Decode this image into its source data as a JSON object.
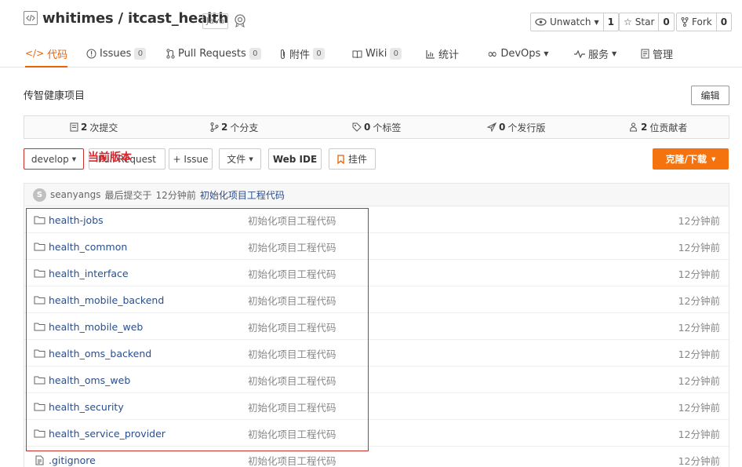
{
  "repo": {
    "owner": "whitimes",
    "name": "itcast_health",
    "separator": " / ",
    "language": "Java"
  },
  "actions": {
    "watch": {
      "label": "Unwatch",
      "count": "1"
    },
    "star": {
      "label": "Star",
      "count": "0"
    },
    "fork": {
      "label": "Fork",
      "count": "0"
    }
  },
  "nav": {
    "code": "代码",
    "issues": {
      "label": "Issues",
      "count": "0"
    },
    "pull_requests": {
      "label": "Pull Requests",
      "count": "0"
    },
    "attachments": {
      "label": "附件",
      "count": "0"
    },
    "wiki": {
      "label": "Wiki",
      "count": "0"
    },
    "stats": "统计",
    "devops": "DevOps",
    "services": "服务",
    "manage": "管理"
  },
  "description": "传智健康项目",
  "edit_label": "编辑",
  "stats": {
    "commits": {
      "num": "2",
      "label": "次提交"
    },
    "branches": {
      "num": "2",
      "label": "个分支"
    },
    "tags": {
      "num": "0",
      "label": "个标签"
    },
    "releases": {
      "num": "0",
      "label": "个发行版"
    },
    "contributors": {
      "num": "2",
      "label": "位贡献者"
    }
  },
  "toolbar": {
    "branch": "develop",
    "pull_request": "Pull Request",
    "issue": "+ Issue",
    "file": "文件",
    "web_ide": "Web IDE",
    "mount": "挂件",
    "clone": "克隆/下载"
  },
  "annotation": "当前版本",
  "last_commit": {
    "avatar_initial": "S",
    "author": "seanyangs",
    "text": "最后提交于",
    "time": "12分钟前",
    "message": "初始化项目工程代码"
  },
  "files": [
    {
      "name": "health-jobs",
      "type": "folder",
      "message": "初始化项目工程代码",
      "time": "12分钟前"
    },
    {
      "name": "health_common",
      "type": "folder",
      "message": "初始化项目工程代码",
      "time": "12分钟前"
    },
    {
      "name": "health_interface",
      "type": "folder",
      "message": "初始化项目工程代码",
      "time": "12分钟前"
    },
    {
      "name": "health_mobile_backend",
      "type": "folder",
      "message": "初始化项目工程代码",
      "time": "12分钟前"
    },
    {
      "name": "health_mobile_web",
      "type": "folder",
      "message": "初始化项目工程代码",
      "time": "12分钟前"
    },
    {
      "name": "health_oms_backend",
      "type": "folder",
      "message": "初始化项目工程代码",
      "time": "12分钟前"
    },
    {
      "name": "health_oms_web",
      "type": "folder",
      "message": "初始化项目工程代码",
      "time": "12分钟前"
    },
    {
      "name": "health_security",
      "type": "folder",
      "message": "初始化项目工程代码",
      "time": "12分钟前"
    },
    {
      "name": "health_service_provider",
      "type": "folder",
      "message": "初始化项目工程代码",
      "time": "12分钟前"
    },
    {
      "name": ".gitignore",
      "type": "file",
      "message": "初始化项目工程代码",
      "time": "12分钟前"
    }
  ]
}
